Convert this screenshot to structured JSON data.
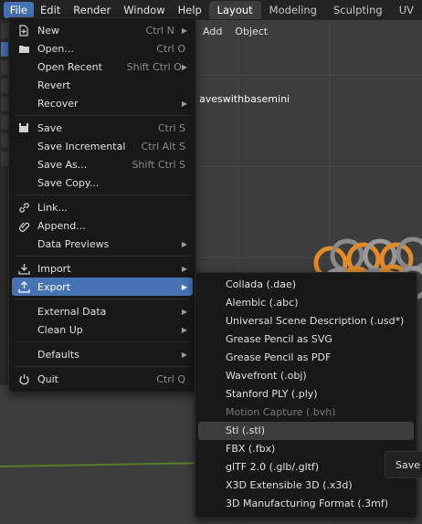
{
  "topbar": {
    "menus": [
      "File",
      "Edit",
      "Render",
      "Window",
      "Help"
    ],
    "workspaces": [
      "Layout",
      "Modeling",
      "Sculpting",
      "UV"
    ]
  },
  "viewport": {
    "header": [
      "Add",
      "Object"
    ],
    "object_name": "aveswithbasemini"
  },
  "file_menu": {
    "items": [
      {
        "label": "New",
        "shortcut": "Ctrl N",
        "submenu": true,
        "icon": "new-file-icon"
      },
      {
        "label": "Open...",
        "shortcut": "Ctrl O",
        "submenu": false,
        "icon": "folder-icon"
      },
      {
        "label": "Open Recent",
        "shortcut": "Shift Ctrl O",
        "submenu": true,
        "icon": ""
      },
      {
        "label": "Revert",
        "shortcut": "",
        "submenu": false,
        "icon": ""
      },
      {
        "label": "Recover",
        "shortcut": "",
        "submenu": true,
        "icon": ""
      },
      {
        "label": "Save",
        "shortcut": "Ctrl S",
        "submenu": false,
        "icon": "save-icon"
      },
      {
        "label": "Save Incremental",
        "shortcut": "Ctrl Alt S",
        "submenu": false,
        "icon": ""
      },
      {
        "label": "Save As...",
        "shortcut": "Shift Ctrl S",
        "submenu": false,
        "icon": ""
      },
      {
        "label": "Save Copy...",
        "shortcut": "",
        "submenu": false,
        "icon": ""
      },
      {
        "label": "Link...",
        "shortcut": "",
        "submenu": false,
        "icon": "link-icon"
      },
      {
        "label": "Append...",
        "shortcut": "",
        "submenu": false,
        "icon": "append-icon"
      },
      {
        "label": "Data Previews",
        "shortcut": "",
        "submenu": true,
        "icon": ""
      },
      {
        "label": "Import",
        "shortcut": "",
        "submenu": true,
        "icon": "import-icon"
      },
      {
        "label": "Export",
        "shortcut": "",
        "submenu": true,
        "icon": "export-icon"
      },
      {
        "label": "External Data",
        "shortcut": "",
        "submenu": true,
        "icon": ""
      },
      {
        "label": "Clean Up",
        "shortcut": "",
        "submenu": true,
        "icon": ""
      },
      {
        "label": "Defaults",
        "shortcut": "",
        "submenu": true,
        "icon": ""
      },
      {
        "label": "Quit",
        "shortcut": "Ctrl Q",
        "submenu": false,
        "icon": "power-icon"
      }
    ]
  },
  "export_menu": {
    "items": [
      {
        "label": "Collada (.dae)",
        "enabled": true
      },
      {
        "label": "Alembic (.abc)",
        "enabled": true
      },
      {
        "label": "Universal Scene Description (.usd*)",
        "enabled": true
      },
      {
        "label": "Grease Pencil as SVG",
        "enabled": true
      },
      {
        "label": "Grease Pencil as PDF",
        "enabled": true
      },
      {
        "label": "Wavefront (.obj)",
        "enabled": true
      },
      {
        "label": "Stanford PLY (.ply)",
        "enabled": true
      },
      {
        "label": "Motion Capture (.bvh)",
        "enabled": false
      },
      {
        "label": "Stl (.stl)",
        "enabled": true
      },
      {
        "label": "FBX (.fbx)",
        "enabled": true
      },
      {
        "label": "glTF 2.0 (.glb/.gltf)",
        "enabled": true
      },
      {
        "label": "X3D Extensible 3D (.x3d)",
        "enabled": true
      },
      {
        "label": "3D Manufacturing Format (.3mf)",
        "enabled": true
      }
    ]
  },
  "popup": {
    "label": "Save"
  },
  "colors": {
    "highlight": "#4772b3",
    "menu_bg": "#181818"
  }
}
